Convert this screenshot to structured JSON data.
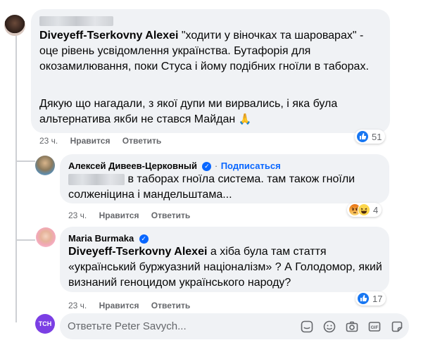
{
  "comment1": {
    "author_blurred": true,
    "tag": "Diveyeff-Tserkovny Alexei",
    "text_after_tag": " \"ходити у віночках та шароварах\" - оце рівень усвідомлення українства. Бутафорія для окозамилювання, поки Стуса і йому подібних гноїли в таборах.",
    "paragraph2": "Дякую що нагадали, з якої дупи ми вирвались, і яка була альтернатива якби не стався Майдан",
    "emoji": "🙏",
    "time": "23 ч.",
    "like": "Нравится",
    "reply": "Ответить",
    "reaction_count": "51",
    "reaction_icon": "like-icon"
  },
  "comment2": {
    "author": "Алексей Дивеев-Церковный",
    "verified": "✓",
    "separator": "·",
    "follow": "Подписаться",
    "text_line1": " в таборах гноїла система. там також гноїли",
    "text_line2": "солженіцина і мандельштама...",
    "time": "23 ч.",
    "like": "Нравится",
    "reply": "Ответить",
    "reaction_count": "4",
    "reaction_icons": [
      "angry-icon",
      "haha-icon"
    ]
  },
  "comment3": {
    "author": "Maria Burmaka",
    "verified": "✓",
    "tag": "Diveyeff-Tserkovny Alexei",
    "text_after_tag": " а хіба була там стаття «український буржуазний націоналізм» ? А Голодомор, який визнаний геноцидом українського народу?",
    "time": "23 ч.",
    "like": "Нравится",
    "reply": "Ответить",
    "reaction_count": "17",
    "reaction_icon": "like-icon"
  },
  "reply_box": {
    "placeholder": "Ответьте Peter Savych...",
    "avatar_text": "ТСН",
    "icons": [
      "sticker-icon",
      "emoji-icon",
      "camera-icon",
      "gif-icon",
      "sticker-alt-icon"
    ]
  },
  "colors": {
    "bubble": "#f0f2f5",
    "link_blue": "#0866ff",
    "meta_gray": "#65676b",
    "tsn_purple": "#7b3fe4"
  }
}
